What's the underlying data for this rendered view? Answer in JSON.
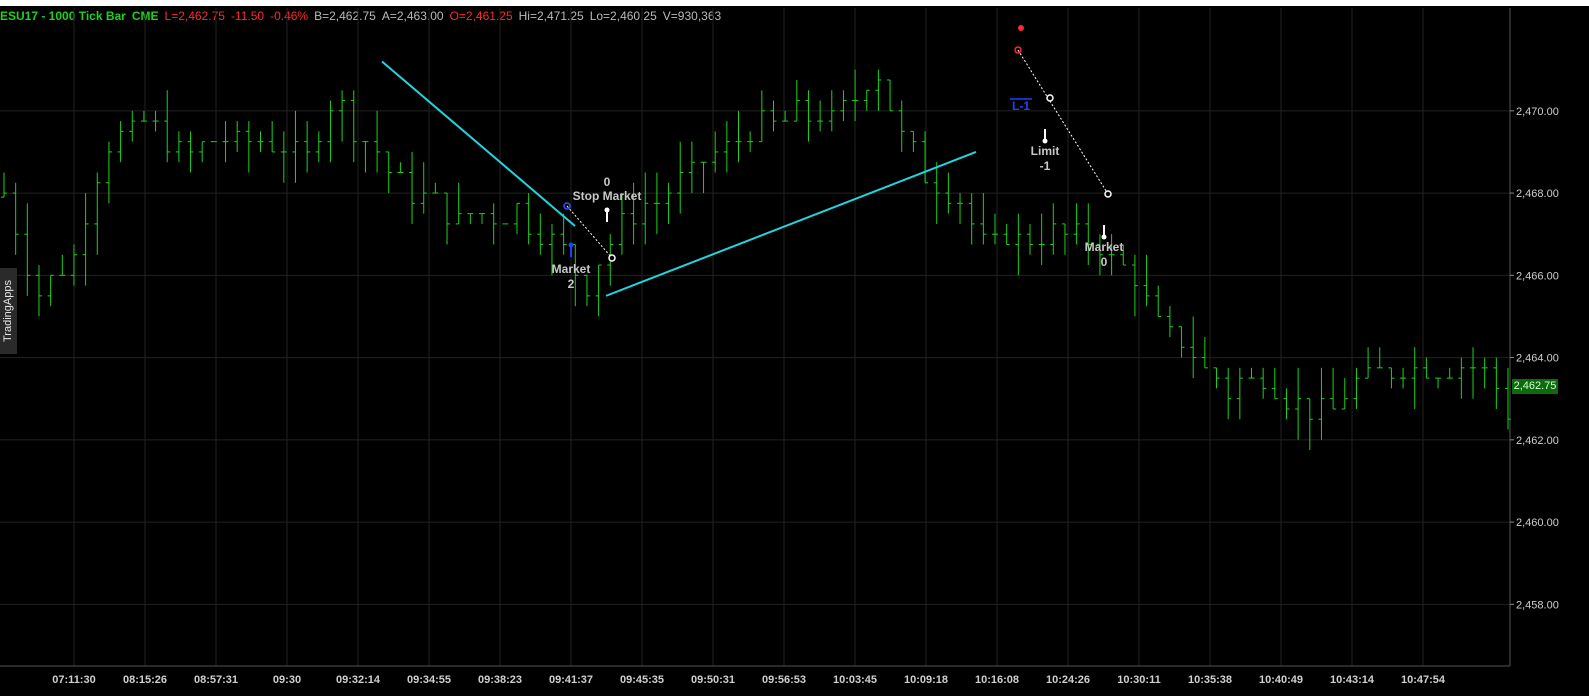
{
  "header": {
    "symbol": "ESU17 - 1000 Tick Bar",
    "exchange": "CME",
    "last": "L=2,462.75",
    "change": "-11.50",
    "change_pct": "-0.46%",
    "bid": "B=2,462.75",
    "ask": "A=2,463.00",
    "open": "O=2,461.25",
    "high": "Hi=2,471.25",
    "low": "Lo=2,460.25",
    "volume": "V=930,363"
  },
  "side_tab": {
    "label": "TradingApps"
  },
  "last_price_tag": "2,462.75",
  "colors": {
    "background": "#000000",
    "bar": "#1dd11d",
    "trendline": "#21d5e0",
    "grid": "#222222",
    "axis_text": "#cfcfcf",
    "order_text": "#c8c8c8"
  },
  "chart_data": {
    "type": "ohlc",
    "ylim": [
      2456.5,
      2472.5
    ],
    "grid": true,
    "price_axis_side": "right",
    "y_ticks": [
      "2,458.00",
      "2,460.00",
      "2,462.00",
      "2,464.00",
      "2,466.00",
      "2,468.00",
      "2,470.00"
    ],
    "y_tick_values": [
      2458,
      2460,
      2462,
      2464,
      2466,
      2468,
      2470
    ],
    "x_tick_labels": [
      "07:11:30",
      "08:15:26",
      "08:57:31",
      "09:30",
      "09:32:14",
      "09:34:55",
      "09:38:23",
      "09:41:37",
      "09:45:35",
      "09:50:31",
      "09:56:53",
      "10:03:45",
      "10:09:18",
      "10:16:08",
      "10:24:26",
      "10:30:11",
      "10:35:38",
      "10:40:49",
      "10:43:14",
      "10:47:54"
    ],
    "bar_count": 130,
    "bars_close_path": [
      [
        0,
        2467.9
      ],
      [
        5,
        2465.6
      ],
      [
        10,
        2466.2
      ],
      [
        15,
        2469.0
      ],
      [
        22,
        2469.8
      ],
      [
        27,
        2469.0
      ],
      [
        33,
        2469.2
      ],
      [
        40,
        2469.2
      ],
      [
        46,
        2468.8
      ],
      [
        50,
        2470.3
      ],
      [
        56,
        2469.1
      ],
      [
        62,
        2468.0
      ],
      [
        69,
        2467.4
      ],
      [
        73,
        2467.4
      ],
      [
        78,
        2467.6
      ],
      [
        84,
        2466.8
      ],
      [
        89,
        2465.8
      ],
      [
        93,
        2467.0
      ],
      [
        101,
        2468.1
      ],
      [
        107,
        2468.8
      ],
      [
        114,
        2469.6
      ],
      [
        120,
        2469.9
      ],
      [
        126,
        2469.8
      ],
      [
        133,
        2470.9
      ],
      [
        136,
        2469.5
      ],
      [
        141,
        2468.3
      ],
      [
        146,
        2467.7
      ],
      [
        149,
        2466.8
      ],
      [
        153,
        2466.9
      ],
      [
        160,
        2467.0
      ],
      [
        166,
        2466.8
      ],
      [
        172,
        2466.0
      ],
      [
        176,
        2464.6
      ],
      [
        180,
        2464.3
      ],
      [
        186,
        2463.2
      ],
      [
        191,
        2463.6
      ],
      [
        197,
        2462.8
      ],
      [
        202,
        2462.7
      ],
      [
        206,
        2463.5
      ],
      [
        214,
        2463.8
      ],
      [
        220,
        2463.8
      ],
      [
        226,
        2463.7
      ],
      [
        229,
        2462.75
      ]
    ],
    "trendlines": [
      {
        "from": [
          "09:32:14",
          2471.2
        ],
        "to": [
          "09:41:37",
          2467.2
        ]
      },
      {
        "from": [
          "09:45:35",
          2465.5
        ],
        "to": [
          "10:16:08",
          2469.0
        ]
      }
    ],
    "annotations": [
      {
        "text": "Stop Market",
        "position": "above"
      },
      {
        "text": "0",
        "position": "above"
      },
      {
        "text": "Market",
        "position": "below"
      },
      {
        "text": "2",
        "position": "below"
      },
      {
        "text": "L-1",
        "position": "above"
      },
      {
        "text": "Limit",
        "position": "below"
      },
      {
        "text": "-1",
        "position": "below"
      },
      {
        "text": "Market",
        "position": "below"
      },
      {
        "text": "0",
        "position": "below"
      }
    ]
  }
}
